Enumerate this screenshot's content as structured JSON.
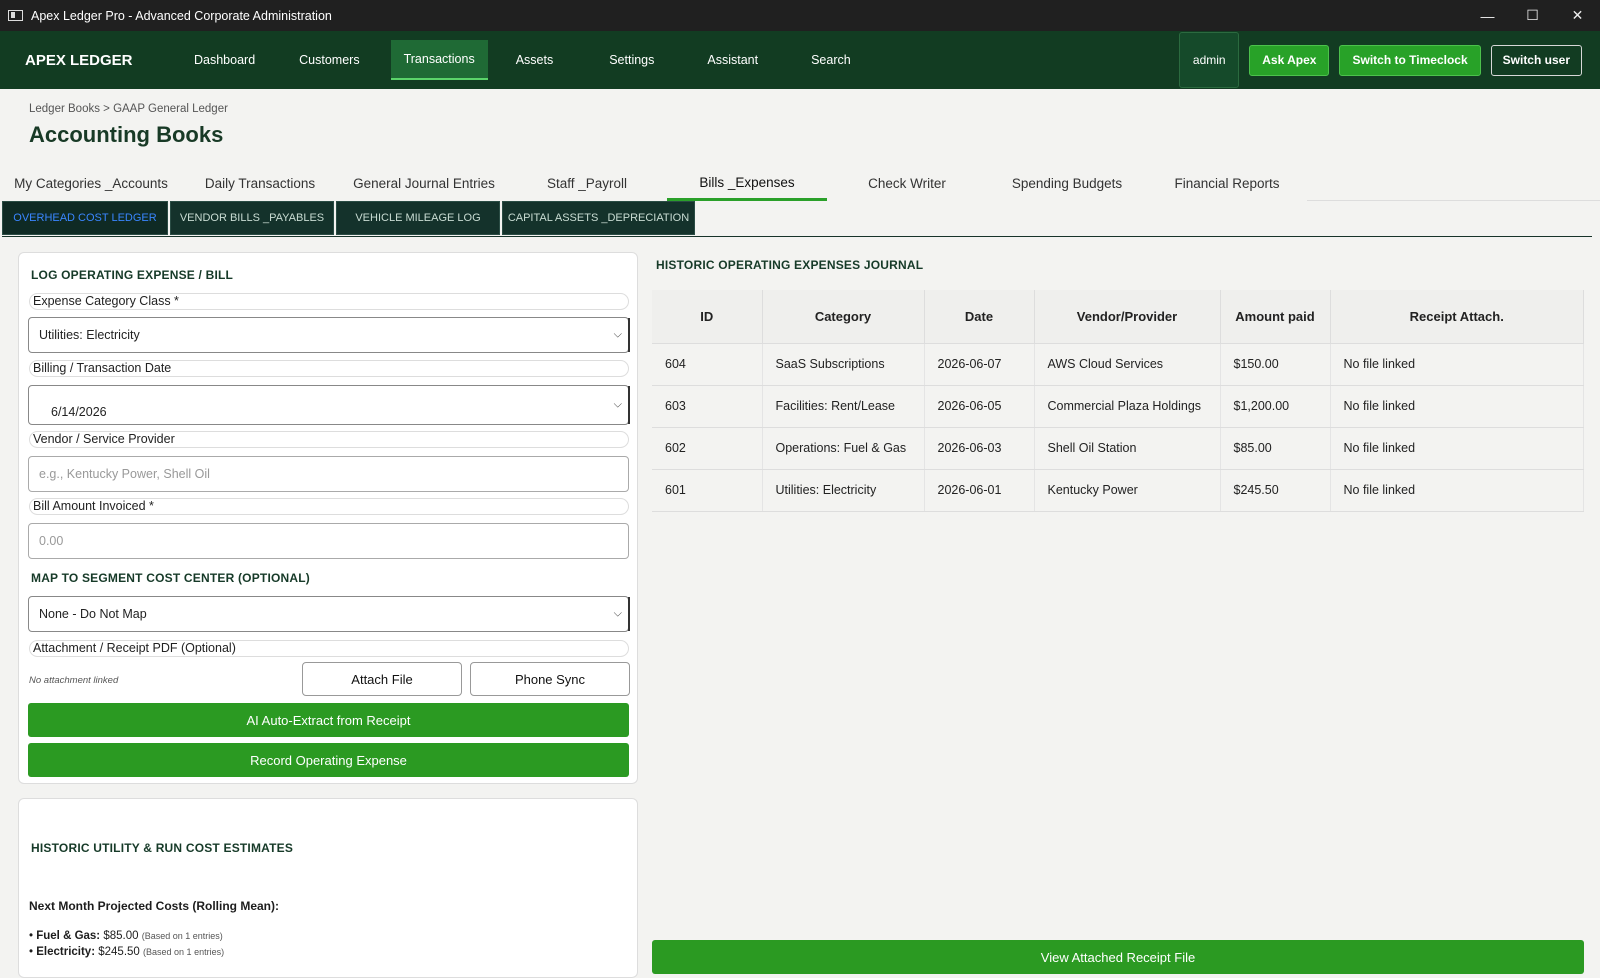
{
  "window": {
    "title": "Apex Ledger Pro - Advanced Corporate Administration",
    "minimize": "—",
    "maximize": "☐",
    "close": "✕"
  },
  "nav": {
    "brand": "APEX LEDGER",
    "items": [
      "Dashboard",
      "Customers",
      "Transactions",
      "Assets",
      "Settings",
      "Assistant",
      "Search"
    ],
    "active": "Transactions",
    "user": "admin",
    "ask": "Ask Apex",
    "timeclock": "Switch to Timeclock",
    "switch_user": "Switch user"
  },
  "breadcrumb": "Ledger Books > GAAP General Ledger",
  "page_title": "Accounting Books",
  "main_tabs": [
    "My Categories _Accounts",
    "Daily Transactions",
    "General Journal Entries",
    "Staff _Payroll",
    "Bills _Expenses",
    "Check Writer",
    "Spending Budgets",
    "Financial Reports"
  ],
  "main_tab_active": "Bills _Expenses",
  "sub_tabs": [
    "OVERHEAD COST LEDGER",
    "VENDOR BILLS _PAYABLES",
    "VEHICLE MILEAGE LOG",
    "CAPITAL ASSETS _DEPRECIATION"
  ],
  "sub_tab_active": "OVERHEAD COST LEDGER",
  "form": {
    "title": "LOG OPERATING EXPENSE / BILL",
    "category_label": "Expense Category Class *",
    "category_value": "Utilities: Electricity",
    "date_label": "Billing / Transaction Date",
    "date_value": "6/14/2026",
    "vendor_label": "Vendor / Service Provider",
    "vendor_placeholder": "e.g., Kentucky Power, Shell Oil",
    "amount_label": "Bill Amount Invoiced *",
    "amount_placeholder": "0.00",
    "segment_title": "MAP TO SEGMENT COST CENTER (OPTIONAL)",
    "segment_value": "None - Do Not Map",
    "attach_label": "Attachment / Receipt PDF (Optional)",
    "attach_status": "No attachment linked",
    "attach_btn": "Attach File",
    "phone_btn": "Phone Sync",
    "ai_btn": "AI Auto-Extract from Receipt",
    "record_btn": "Record Operating Expense"
  },
  "estimates": {
    "title": "HISTORIC UTILITY & RUN COST ESTIMATES",
    "subtitle": "Next Month Projected Costs (Rolling Mean):",
    "lines": [
      {
        "bullet": "•",
        "label": "Fuel & Gas:",
        "value": "$85.00",
        "note": "(Based on 1 entries)"
      },
      {
        "bullet": "•",
        "label": "Electricity:",
        "value": "$245.50",
        "note": "(Based on 1 entries)"
      }
    ]
  },
  "journal": {
    "title": "HISTORIC OPERATING EXPENSES JOURNAL",
    "columns": [
      "ID",
      "Category",
      "Date",
      "Vendor/Provider",
      "Amount paid",
      "Receipt Attach."
    ],
    "rows": [
      [
        "604",
        "SaaS Subscriptions",
        "2026-06-07",
        "AWS Cloud Services",
        "$150.00",
        "No file linked"
      ],
      [
        "603",
        "Facilities: Rent/Lease",
        "2026-06-05",
        "Commercial Plaza Holdings",
        "$1,200.00",
        "No file linked"
      ],
      [
        "602",
        "Operations: Fuel & Gas",
        "2026-06-03",
        "Shell Oil Station",
        "$85.00",
        "No file linked"
      ],
      [
        "601",
        "Utilities: Electricity",
        "2026-06-01",
        "Kentucky Power",
        "$245.50",
        "No file linked"
      ]
    ],
    "view_btn": "View Attached Receipt File"
  }
}
